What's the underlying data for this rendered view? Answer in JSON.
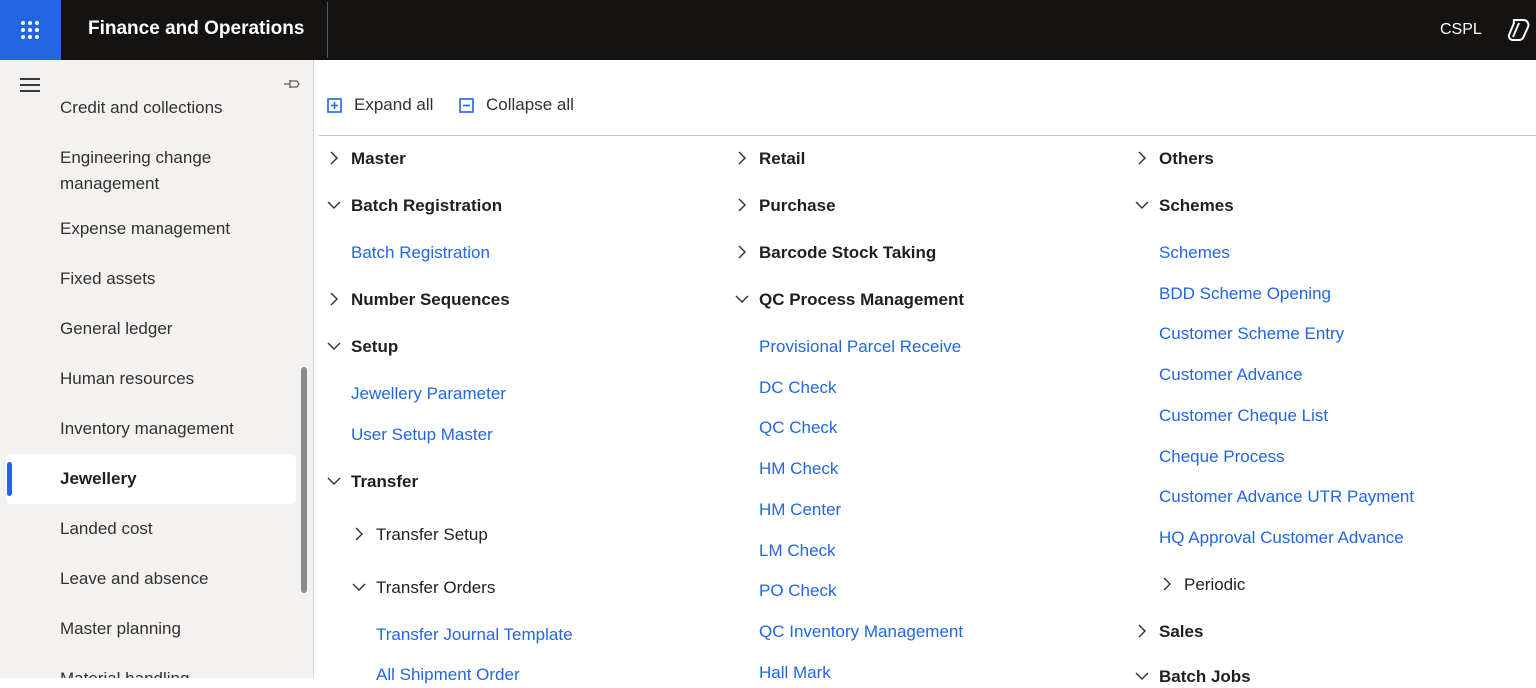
{
  "header": {
    "app_title": "Finance and Operations",
    "company": "CSPL",
    "waffle_icon": "app-launcher-icon",
    "copilot_icon": "copilot-icon"
  },
  "sidebar": {
    "items": [
      {
        "label": "Credit and collections"
      },
      {
        "label": "Engineering change management"
      },
      {
        "label": "Expense management"
      },
      {
        "label": "Fixed assets"
      },
      {
        "label": "General ledger"
      },
      {
        "label": "Human resources"
      },
      {
        "label": "Inventory management"
      },
      {
        "label": "Jewellery",
        "selected": true
      },
      {
        "label": "Landed cost"
      },
      {
        "label": "Leave and absence"
      },
      {
        "label": "Master planning"
      },
      {
        "label": "Material handling"
      }
    ],
    "accent_color": "#2266e3"
  },
  "toolbar": {
    "expand_all": "Expand all",
    "collapse_all": "Collapse all"
  },
  "col1": {
    "master": "Master",
    "batch_registration": "Batch Registration",
    "batch_registration_link": "Batch Registration",
    "number_sequences": "Number Sequences",
    "setup": "Setup",
    "jewellery_parameter": "Jewellery Parameter",
    "user_setup_master": "User Setup Master",
    "transfer": "Transfer",
    "transfer_setup": "Transfer Setup",
    "transfer_orders": "Transfer Orders",
    "transfer_journal_template": "Transfer Journal Template",
    "all_shipment_order": "All Shipment Order"
  },
  "col2": {
    "retail": "Retail",
    "purchase": "Purchase",
    "barcode_stock_taking": "Barcode Stock Taking",
    "qc_process_management": "QC Process Management",
    "links": [
      "Provisional Parcel Receive",
      "DC Check",
      "QC Check",
      "HM Check",
      "HM Center",
      "LM Check",
      "PO Check",
      "QC Inventory Management",
      "Hall Mark"
    ]
  },
  "col3": {
    "others": "Others",
    "schemes": "Schemes",
    "links": [
      "Schemes",
      "BDD Scheme Opening",
      "Customer Scheme Entry",
      "Customer Advance",
      "Customer Cheque List",
      "Cheque Process",
      "Customer Advance UTR Payment",
      "HQ Approval Customer Advance"
    ],
    "periodic": "Periodic",
    "sales": "Sales",
    "batch_jobs": "Batch Jobs"
  }
}
